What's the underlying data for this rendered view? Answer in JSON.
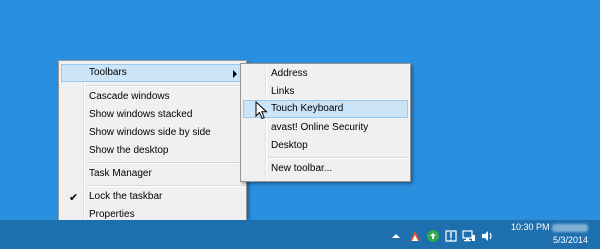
{
  "main_menu": {
    "items": [
      {
        "label": "Toolbars"
      },
      {
        "label": "Cascade windows"
      },
      {
        "label": "Show windows stacked"
      },
      {
        "label": "Show windows side by side"
      },
      {
        "label": "Show the desktop"
      },
      {
        "label": "Task Manager"
      },
      {
        "label": "Lock the taskbar",
        "checked": true
      },
      {
        "label": "Properties"
      }
    ]
  },
  "sub_menu": {
    "items": [
      {
        "label": "Address"
      },
      {
        "label": "Links"
      },
      {
        "label": "Touch Keyboard"
      },
      {
        "label": "avast! Online Security"
      },
      {
        "label": "Desktop"
      },
      {
        "label": "New toolbar..."
      }
    ]
  },
  "tray": {
    "time": "10:30 PM",
    "date": "5/3/2014",
    "icons": [
      "show-hidden-icons",
      "avast-icon",
      "network-update-icon",
      "action-center-icon",
      "network-icon",
      "volume-icon"
    ]
  },
  "colors": {
    "desktop": "#2b8fe0",
    "taskbar": "#1e6fae",
    "menu_bg": "#f0f0f0",
    "highlight": "#cce4f7"
  }
}
